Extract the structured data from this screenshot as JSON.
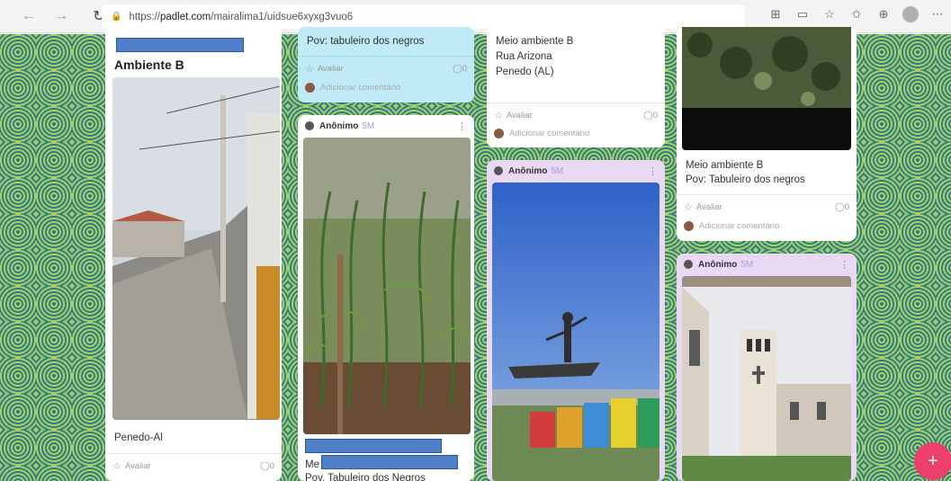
{
  "browser": {
    "url_prefix": "https://",
    "url_host": "padlet.com",
    "url_path": "/mairalima1/uidsue6xyxg3vuo6",
    "icons": [
      "back-icon",
      "forward-icon",
      "reload-icon",
      "lock-icon",
      "apps-icon",
      "reader-icon",
      "favorite-icon",
      "favorites-bar-icon",
      "collections-icon",
      "profile-icon",
      "more-icon"
    ]
  },
  "colors": {
    "accent": "#ec3f6b",
    "blue_card": "#bfeaf6",
    "lilac_card": "#ead9f5",
    "age": "#b29adb"
  },
  "col1": {
    "card1": {
      "title": "Ambiente B",
      "caption": "Penedo-Al",
      "rate": "Avaliar",
      "count": "0"
    }
  },
  "col2": {
    "card_top": {
      "text": "Pov: tabuleiro dos negros",
      "rate": "Avaliar",
      "count": "0",
      "comment": "Adicionar comentário"
    },
    "card2": {
      "author": "Anônimo",
      "age": "5M",
      "text1": "Me",
      "text2": "Pov. Tabuleiro dos Negros"
    }
  },
  "col3": {
    "card_top": {
      "line1": "Meio ambiente B",
      "line2": "Rua Arizona",
      "line3": "Penedo (AL)",
      "rate": "Avaliar",
      "count": "0",
      "comment": "Adicionar comentário"
    },
    "card2": {
      "author": "Anônimo",
      "age": "5M"
    }
  },
  "col4": {
    "card_top": {
      "line1": "Meio ambiente B",
      "line2": "Pov: Tabuleiro dos negros",
      "rate": "Avaliar",
      "count": "0",
      "comment": "Adicionar comentário"
    },
    "card2": {
      "author": "Anônimo",
      "age": "5M"
    }
  },
  "fab": {
    "label": "+"
  }
}
